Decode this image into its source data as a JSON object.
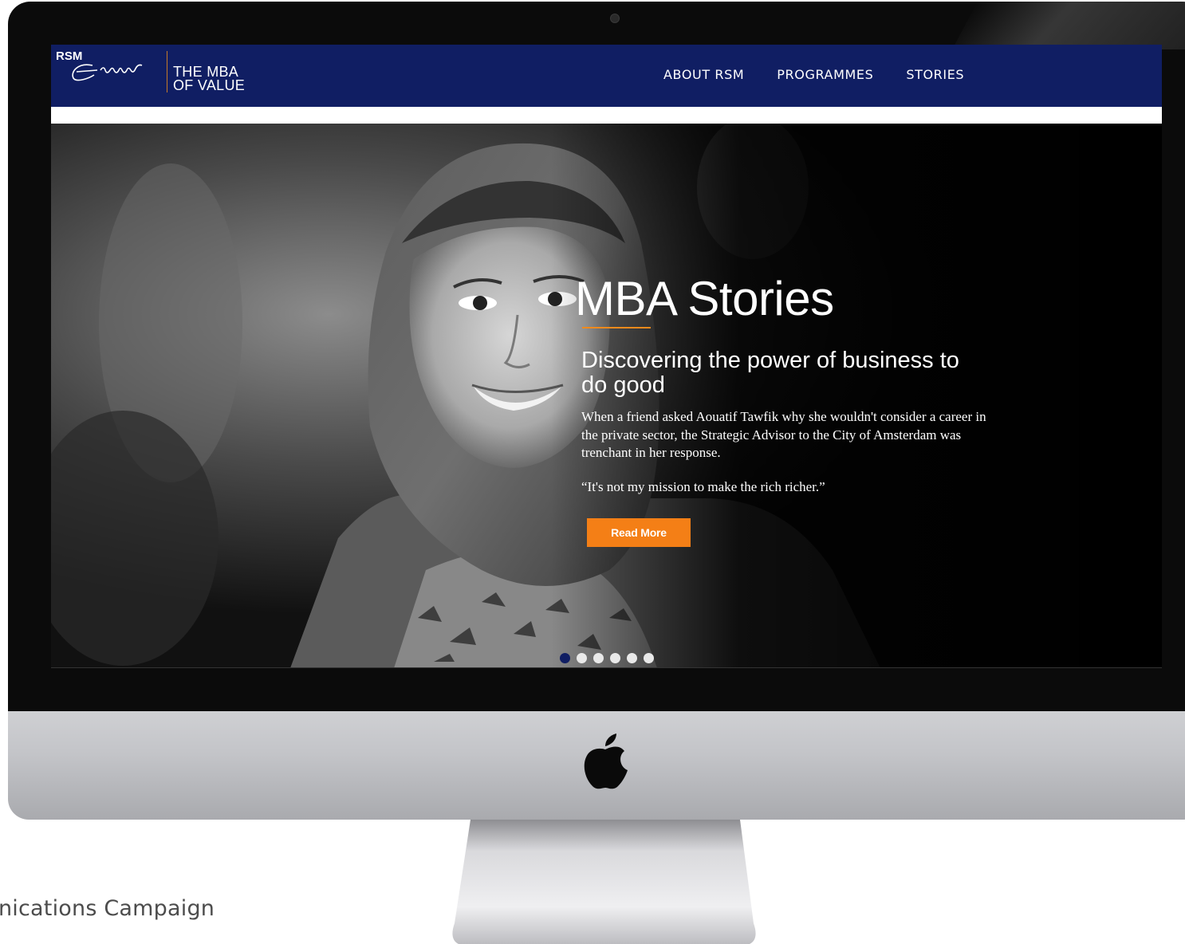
{
  "nav": {
    "logo_rsm": "RSM",
    "logo_script": "Erasmus",
    "logo_tagline_line1": "THE MBA",
    "logo_tagline_line2": "OF VALUE",
    "links": [
      "ABOUT RSM",
      "PROGRAMMES",
      "STORIES"
    ]
  },
  "hero": {
    "title": "MBA Stories",
    "subtitle": "Discovering the power of business to do good",
    "body": "When a friend asked Aouatif Tawfik why she wouldn't consider a career in the private sector, the Strategic Advisor to the City of Amsterdam was trenchant in her response.",
    "quote": "“It's not my mission to make the rich richer.”",
    "cta_label": "Read More",
    "slide_count": 6,
    "active_slide": 1
  },
  "caption": "nications Campaign",
  "colors": {
    "navy": "#101e63",
    "orange": "#f47f16",
    "accent_line": "#c57a2a"
  }
}
